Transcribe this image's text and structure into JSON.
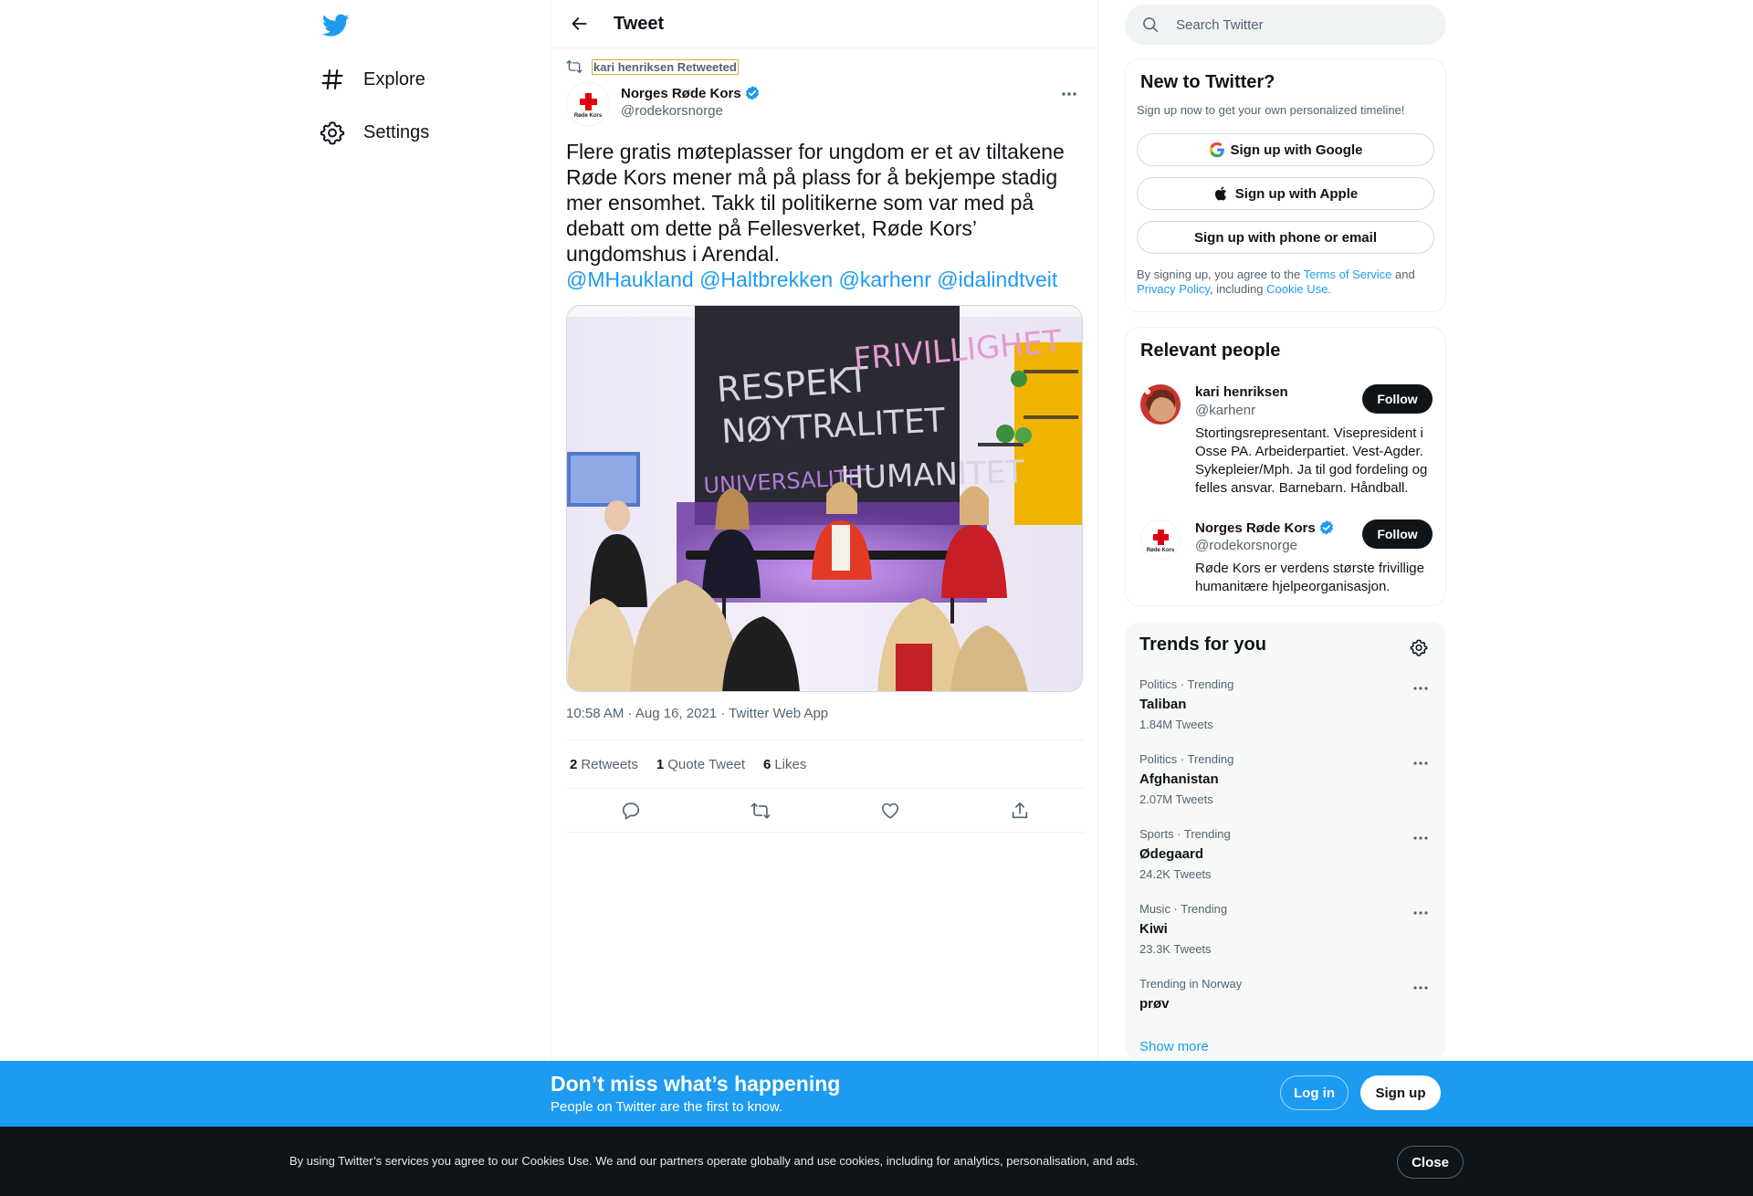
{
  "nav": {
    "explore_label": "Explore",
    "settings_label": "Settings"
  },
  "header": {
    "title": "Tweet"
  },
  "tweet": {
    "retweeted_by": "kari henriksen Retweeted",
    "author_name": "Norges Røde Kors",
    "author_handle": "@rodekorsnorge",
    "avatar_text": "Røde Kors",
    "text": "Flere gratis møteplasser for ungdom er et av tiltakene Røde Kors mener må på plass for å bekjempe stadig mer ensomhet. Takk til politikerne som var med på debatt om dette på Fellesverket, Røde Kors’ ungdomshus i Arendal.",
    "mentions": [
      "@MHaukland",
      "@Haltbrekken",
      "@karhenr",
      "@idalindtveit"
    ],
    "image_board_words": [
      "RESPEKT",
      "NØYTRALITET",
      "FRIVILLIGHET",
      "UNIVERSALITET",
      "HUMANITET"
    ],
    "meta": "10:58 AM · Aug 16, 2021 · Twitter Web App",
    "stats": {
      "retweets_count": "2",
      "retweets_label": "Retweets",
      "quotes_count": "1",
      "quotes_label": "Quote Tweet",
      "likes_count": "6",
      "likes_label": "Likes"
    }
  },
  "search": {
    "placeholder": "Search Twitter"
  },
  "new_to_twitter": {
    "title": "New to Twitter?",
    "subtitle": "Sign up now to get your own personalized timeline!",
    "google_label": "Sign up with Google",
    "apple_label": "Sign up with Apple",
    "phone_label": "Sign up with phone or email",
    "legal_prefix": "By signing up, you agree to the ",
    "terms_link": "Terms of Service",
    "legal_and": " and ",
    "privacy_link": "Privacy Policy",
    "legal_including": ", including ",
    "cookie_link": "Cookie Use."
  },
  "relevant_people": {
    "title": "Relevant people",
    "people": [
      {
        "name": "kari henriksen",
        "handle": "@karhenr",
        "bio": "Stortingsrepresentant. Visepresident i Osse PA. Arbeiderpartiet. Vest-Agder. Sykepleier/Mph. Ja til god fordeling og felles ansvar. Barnebarn. Håndball.",
        "follow_label": "Follow"
      },
      {
        "name": "Norges Røde Kors",
        "handle": "@rodekorsnorge",
        "bio": "Røde Kors er verdens største frivillige humanitære hjelpeorganisasjon.",
        "follow_label": "Follow"
      }
    ]
  },
  "trends": {
    "title": "Trends for you",
    "items": [
      {
        "context": "Politics · Trending",
        "name": "Taliban",
        "count": "1.84M Tweets"
      },
      {
        "context": "Politics · Trending",
        "name": "Afghanistan",
        "count": "2.07M Tweets"
      },
      {
        "context": "Sports · Trending",
        "name": "Ødegaard",
        "count": "24.2K Tweets"
      },
      {
        "context": "Music · Trending",
        "name": "Kiwi",
        "count": "23.3K Tweets"
      },
      {
        "context": "Trending in Norway",
        "name": "prøv",
        "count": ""
      }
    ],
    "show_more": "Show more"
  },
  "signup_bar": {
    "title": "Don’t miss what’s happening",
    "subtitle": "People on Twitter are the first to know.",
    "login_label": "Log in",
    "signup_label": "Sign up"
  },
  "cookie_bar": {
    "text": "By using Twitter’s services you agree to our Cookies Use. We and our partners operate globally and use cookies, including for analytics, personalisation, and ads.",
    "close_label": "Close"
  },
  "colors": {
    "accent": "#1d9bf0",
    "text_primary": "#0f1419",
    "text_secondary": "#536471",
    "red_cross": "#e1000f"
  },
  "icons": [
    "twitter-logo-icon",
    "hashtag-icon",
    "gear-icon",
    "back-arrow-icon",
    "retweet-icon",
    "verified-icon",
    "more-icon",
    "reply-icon",
    "like-icon",
    "share-icon",
    "search-icon",
    "google-icon",
    "apple-icon"
  ]
}
